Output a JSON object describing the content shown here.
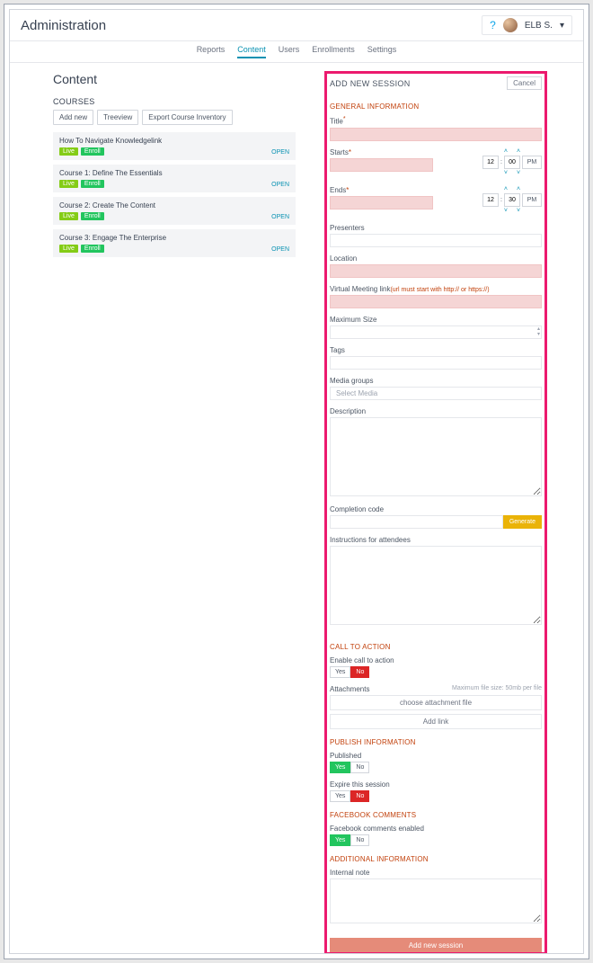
{
  "header": {
    "title": "Administration",
    "user": "ELB S."
  },
  "tabs": [
    "Reports",
    "Content",
    "Users",
    "Enrollments",
    "Settings"
  ],
  "active_tab": "Content",
  "content": {
    "heading": "Content",
    "sub": "COURSES",
    "buttons": {
      "add": "Add new",
      "tree": "Treeview",
      "export": "Export Course Inventory"
    },
    "badges": {
      "live": "Live",
      "enroll": "Enroll",
      "open": "OPEN"
    },
    "courses": [
      "How To Navigate Knowledgelink",
      "Course 1: Define The Essentials",
      "Course 2: Create The Content",
      "Course 3: Engage The Enterprise"
    ]
  },
  "panel": {
    "title": "ADD NEW SESSION",
    "cancel": "Cancel",
    "sections": {
      "general": "GENERAL INFORMATION",
      "cta": "CALL TO ACTION",
      "publish": "PUBLISH INFORMATION",
      "fb": "FACEBOOK COMMENTS",
      "additional": "ADDITIONAL INFORMATION"
    },
    "labels": {
      "title_f": "Title",
      "starts": "Starts",
      "ends": "Ends",
      "presenters": "Presenters",
      "location": "Location",
      "virtual": "Virtual Meeting link",
      "virtual_hint": "(url must start with http:// or https://)",
      "maxsize": "Maximum Size",
      "tags": "Tags",
      "media": "Media groups",
      "media_ph": "Select Media",
      "desc": "Description",
      "code": "Completion code",
      "generate": "Generate",
      "instructions": "Instructions for attendees",
      "enable_cta": "Enable call to action",
      "attachments": "Attachments",
      "att_hint": "Maximum file size: 50mb per file",
      "choose": "choose attachment file",
      "addlink": "Add link",
      "published": "Published",
      "expire": "Expire this session",
      "fb_enabled": "Facebook comments enabled",
      "internal": "Internal note",
      "submit": "Add new session",
      "yes": "Yes",
      "no": "No"
    },
    "time": {
      "start_h": "12",
      "start_m": "00",
      "start_ap": "PM",
      "end_h": "12",
      "end_m": "30",
      "end_ap": "PM"
    }
  }
}
